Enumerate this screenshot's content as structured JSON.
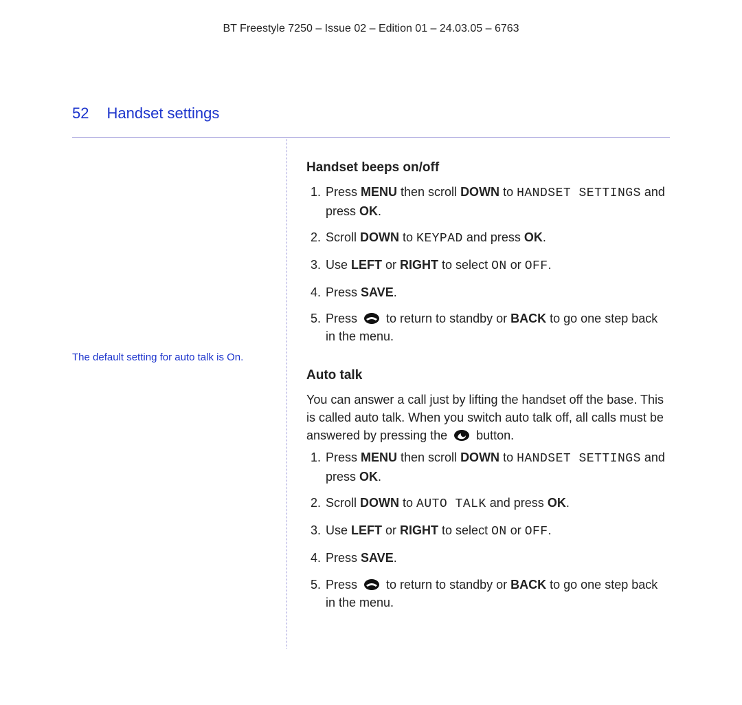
{
  "doc_header": "BT Freestyle 7250 – Issue 02 – Edition 01 – 24.03.05 – 6763",
  "page_number": "52",
  "page_title": "Handset settings",
  "sidebar": {
    "auto_talk_note": "The default setting for auto talk is On."
  },
  "section1": {
    "heading": "Handset beeps on/off",
    "s1_1a": "Press ",
    "s1_1b": "MENU",
    "s1_1c": " then scroll ",
    "s1_1d": "DOWN",
    "s1_1e": " to ",
    "s1_1f": "HANDSET SETTINGS",
    "s1_1g": " and press ",
    "s1_1h": "OK",
    "s1_1i": ".",
    "s1_2a": "Scroll ",
    "s1_2b": "DOWN",
    "s1_2c": " to ",
    "s1_2d": "KEYPAD",
    "s1_2e": " and press ",
    "s1_2f": "OK",
    "s1_2g": ".",
    "s1_3a": "Use ",
    "s1_3b": "LEFT",
    "s1_3c": " or ",
    "s1_3d": "RIGHT",
    "s1_3e": " to select ",
    "s1_3f": "ON",
    "s1_3g": " or ",
    "s1_3h": "OFF",
    "s1_3i": ".",
    "s1_4a": "Press ",
    "s1_4b": "SAVE",
    "s1_4c": ".",
    "s1_5a": "Press ",
    "s1_5b": " to return to standby or ",
    "s1_5c": "BACK",
    "s1_5d": " to go one step back in the menu."
  },
  "section2": {
    "heading": "Auto talk",
    "intro_a": "You can answer a call just by lifting the handset off the base. This is called auto talk. When you switch auto talk off, all calls must be answered by pressing the ",
    "intro_b": " button.",
    "s2_1a": "Press ",
    "s2_1b": "MENU",
    "s2_1c": " then scroll ",
    "s2_1d": "DOWN",
    "s2_1e": " to ",
    "s2_1f": "HANDSET SETTINGS",
    "s2_1g": " and press ",
    "s2_1h": "OK",
    "s2_1i": ".",
    "s2_2a": "Scroll ",
    "s2_2b": "DOWN",
    "s2_2c": " to ",
    "s2_2d": "AUTO TALK",
    "s2_2e": " and press ",
    "s2_2f": "OK",
    "s2_2g": ".",
    "s2_3a": "Use ",
    "s2_3b": "LEFT",
    "s2_3c": " or ",
    "s2_3d": "RIGHT",
    "s2_3e": " to select ",
    "s2_3f": "ON",
    "s2_3g": " or ",
    "s2_3h": "OFF",
    "s2_3i": ".",
    "s2_4a": "Press ",
    "s2_4b": "SAVE",
    "s2_4c": ".",
    "s2_5a": "Press ",
    "s2_5b": " to return to standby or ",
    "s2_5c": "BACK",
    "s2_5d": " to go one step back in the menu."
  }
}
